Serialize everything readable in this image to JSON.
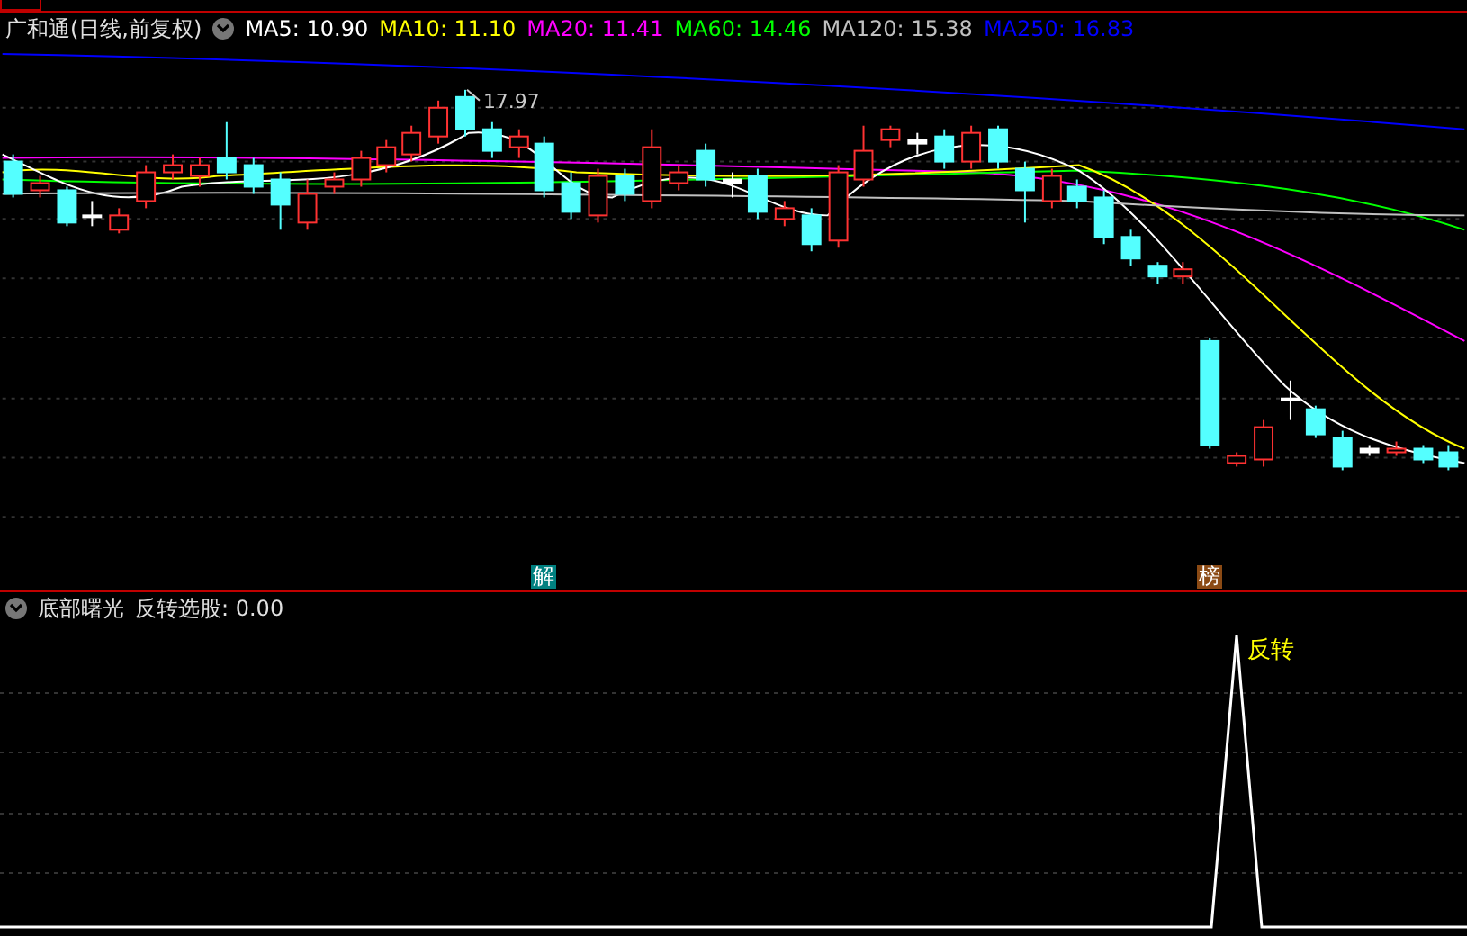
{
  "main_panel": {
    "title": "广和通(日线,前复权)",
    "indicators": [
      {
        "label": "MA5: 10.90",
        "color": "#ffffff"
      },
      {
        "label": "MA10: 11.10",
        "color": "#ffff00"
      },
      {
        "label": "MA20: 11.41",
        "color": "#ff00ff"
      },
      {
        "label": "MA60: 14.46",
        "color": "#00ff00"
      },
      {
        "label": "MA120: 15.38",
        "color": "#c0c0c0"
      },
      {
        "label": "MA250: 16.83",
        "color": "#0000ff"
      }
    ],
    "high_label": "17.97",
    "markers": [
      {
        "text": "解",
        "color": "#008080"
      },
      {
        "text": "榜",
        "color": "#8b4a14"
      }
    ]
  },
  "indicator_panel": {
    "title": "底部曙光",
    "reading": "反转选股: 0.00",
    "signal_label": "反转"
  }
}
